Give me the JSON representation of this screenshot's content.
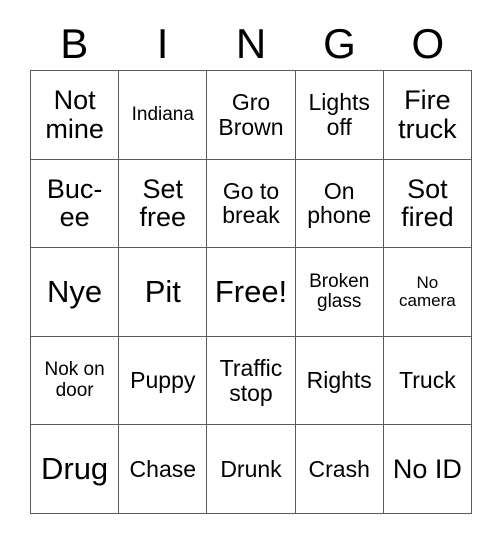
{
  "card": {
    "type": "bingo-card",
    "columns": [
      "B",
      "I",
      "N",
      "G",
      "O"
    ],
    "grid_size": "5x5",
    "free_space": "Free!",
    "colors": {
      "background": "#ffffff",
      "border": "#5a5a5a",
      "text": "#000000"
    },
    "header": [
      {
        "label": "B"
      },
      {
        "label": "I"
      },
      {
        "label": "N"
      },
      {
        "label": "G"
      },
      {
        "label": "O"
      }
    ],
    "rows": [
      {
        "cells": [
          {
            "text": "Not mine",
            "size": "lg"
          },
          {
            "text": "Indiana",
            "size": "sm"
          },
          {
            "text": "Gro Brown",
            "size": "md"
          },
          {
            "text": "Lights off",
            "size": "md"
          },
          {
            "text": "Fire truck",
            "size": "lg"
          }
        ]
      },
      {
        "cells": [
          {
            "text": "Buc-ee",
            "size": "lg"
          },
          {
            "text": "Set free",
            "size": "lg"
          },
          {
            "text": "Go to break",
            "size": "md"
          },
          {
            "text": "On phone",
            "size": "md"
          },
          {
            "text": "Sot fired",
            "size": "lg"
          }
        ]
      },
      {
        "cells": [
          {
            "text": "Nye",
            "size": "xl"
          },
          {
            "text": "Pit",
            "size": "xl"
          },
          {
            "text": "Free!",
            "size": "xl"
          },
          {
            "text": "Broken glass",
            "size": "sm"
          },
          {
            "text": "No camera",
            "size": "xs"
          }
        ]
      },
      {
        "cells": [
          {
            "text": "Nok on door",
            "size": "sm"
          },
          {
            "text": "Puppy",
            "size": "md"
          },
          {
            "text": "Traffic stop",
            "size": "md"
          },
          {
            "text": "Rights",
            "size": "md"
          },
          {
            "text": "Truck",
            "size": "md"
          }
        ]
      },
      {
        "cells": [
          {
            "text": "Drug",
            "size": "xl"
          },
          {
            "text": "Chase",
            "size": "md"
          },
          {
            "text": "Drunk",
            "size": "md"
          },
          {
            "text": "Crash",
            "size": "md"
          },
          {
            "text": "No ID",
            "size": "lg"
          }
        ]
      }
    ]
  }
}
